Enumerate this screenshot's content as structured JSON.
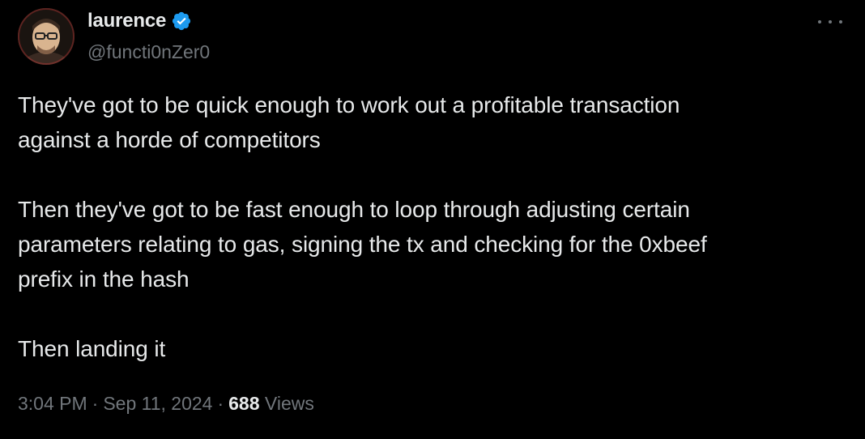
{
  "author": {
    "display_name": "laurence",
    "handle": "@functi0nZer0",
    "verified": true
  },
  "colors": {
    "background": "#000000",
    "text": "#e7e9ea",
    "secondary_text": "#71767b",
    "verified_badge": "#1d9bf0"
  },
  "tweet": {
    "paragraphs": [
      "They've got to be quick enough to work out a profitable transaction\nagainst a horde of competitors",
      "Then they've got to be fast enough to loop through adjusting certain\nparameters relating to gas, signing the tx and checking for the 0xbeef\nprefix in the hash",
      "Then landing it"
    ],
    "time": "3:04 PM",
    "separator": "·",
    "date": "Sep 11, 2024",
    "views_count": "688",
    "views_label": "Views"
  },
  "icons": {
    "verified": "verified-badge-icon",
    "more": "more-options-icon"
  }
}
